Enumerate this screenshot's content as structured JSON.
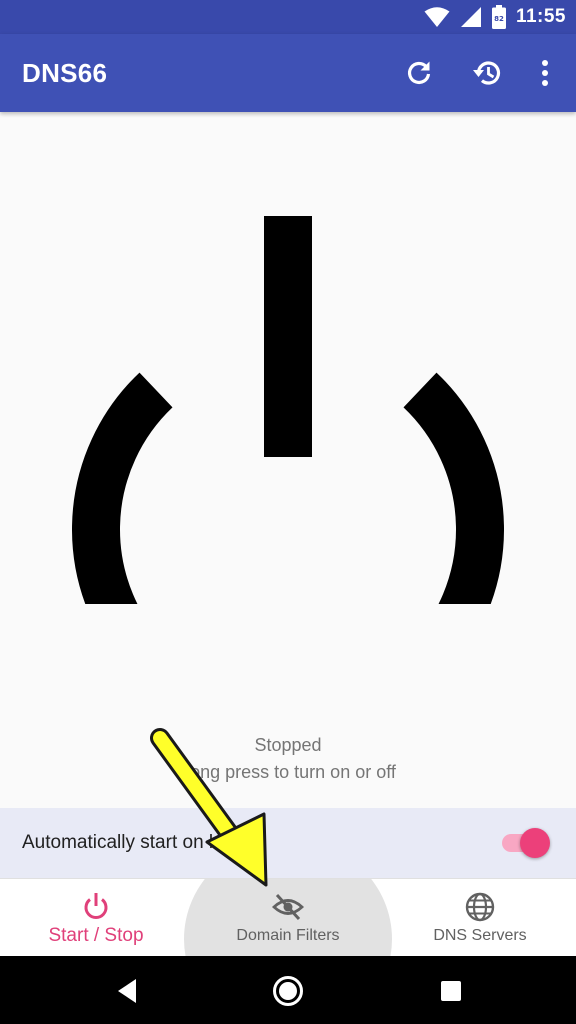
{
  "status_bar": {
    "time": "11:55",
    "battery_level": "82",
    "icons": [
      "wifi-icon",
      "signal-icon",
      "battery-icon"
    ],
    "background": "#3949ab"
  },
  "app_bar": {
    "title": "DNS66",
    "actions": [
      "refresh-icon",
      "history-icon",
      "more-vert-icon"
    ],
    "background": "#3f51b5"
  },
  "main": {
    "power_icon": "power-icon",
    "status": "Stopped",
    "hint": "Long press to turn on or off"
  },
  "autostart": {
    "label": "Automatically start on boot",
    "enabled": true,
    "accent": "#ec407a"
  },
  "bottom_nav": {
    "items": [
      {
        "label": "Start / Stop",
        "icon": "power-icon",
        "active": true
      },
      {
        "label": "Domain Filters",
        "icon": "eye-off-icon",
        "active": false
      },
      {
        "label": "DNS Servers",
        "icon": "globe-icon",
        "active": false
      }
    ],
    "active_color": "#e0407a"
  },
  "system_nav": {
    "buttons": [
      "back-icon",
      "home-icon",
      "recents-icon"
    ]
  },
  "annotation": {
    "arrow_color": "#ffff2a",
    "arrow_icon": "arrow-annotation-icon"
  }
}
